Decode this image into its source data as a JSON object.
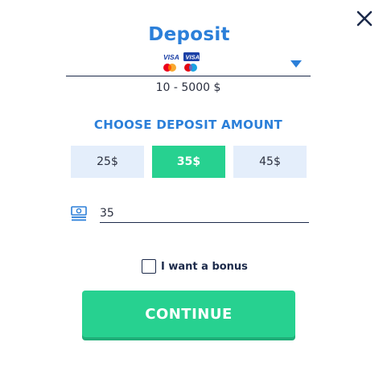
{
  "dialog": {
    "title": "Deposit",
    "close_icon": "close-icon"
  },
  "payment_method": {
    "logos": [
      "visa-logo",
      "visa-electron-logo",
      "mastercard-logo",
      "maestro-logo"
    ],
    "logo_texts": [
      "VISA",
      "VISA"
    ],
    "dropdown_icon": "chevron-down-icon"
  },
  "range_text": "10 - 5000 $",
  "amount_section": {
    "heading": "CHOOSE DEPOSIT AMOUNT",
    "options": [
      "25$",
      "35$",
      "45$"
    ],
    "selected": "35$"
  },
  "amount_input": {
    "icon": "money-icon",
    "value": "35"
  },
  "bonus": {
    "label": "I want a bonus",
    "checked": false
  },
  "continue_label": "CONTINUE",
  "colors": {
    "accent_blue": "#2b7fd9",
    "accent_green": "#27d190",
    "option_bg": "#e4eefb",
    "text_dark": "#1c2a4a"
  }
}
